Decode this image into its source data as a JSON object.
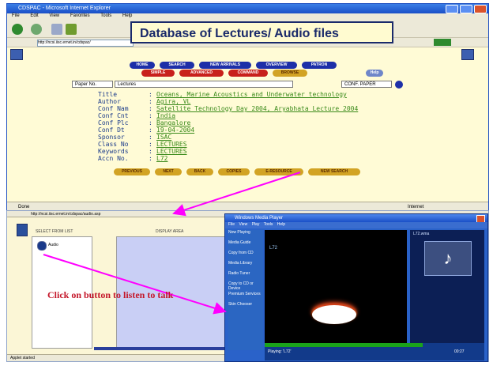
{
  "callout": "Database of Lectures/ Audio files",
  "annotation": "Click on button to listen to talk",
  "ie_window": {
    "title": "CDSPAC - Microsoft Internet Explorer",
    "menu": [
      "File",
      "Edit",
      "View",
      "Favorites",
      "Tools",
      "Help"
    ],
    "address": "http://ncsi.iisc.ernet.in/cdspac/",
    "status_left": "Done",
    "status_right": "Internet"
  },
  "nav_row1": [
    "HOME",
    "SEARCH",
    "NEW ARRIVALS",
    "OVERVIEW",
    "PATRON"
  ],
  "nav_row2": [
    "SIMPLE",
    "ADVANCED",
    "COMMAND",
    "BROWSE"
  ],
  "nav_help": "Help",
  "search_bar": {
    "field": "Paper No.",
    "value": "Lectures",
    "scope": "CONF. PAPER"
  },
  "record": [
    {
      "label": "Title",
      "value": "Oceans, Marine Acoustics and Underwater technology"
    },
    {
      "label": "Author",
      "value": "Agira, VL"
    },
    {
      "label": "Conf Nam",
      "value": "Satellite Technology Day 2004, Aryabhata Lecture 2004"
    },
    {
      "label": "Conf Cnt",
      "value": "India"
    },
    {
      "label": "Conf Plc",
      "value": "Bangalore"
    },
    {
      "label": "Conf Dt",
      "value": "19-04-2004"
    },
    {
      "label": "Sponsor",
      "value": "ISAC"
    },
    {
      "label": "Class No",
      "value": "LECTURES"
    },
    {
      "label": "Keywords",
      "value": "LECTURES"
    },
    {
      "label": "Accn No.",
      "value": "L72"
    }
  ],
  "record_actions": [
    "PREVIOUS",
    "NEXT",
    "BACK",
    "COPIES",
    "E-RESOURCE",
    "NEW SEARCH"
  ],
  "bottom_window": {
    "address": "http://ncsi.iisc.ernet.in/cdspac/audio.asp",
    "list_header": "SELECT FROM LIST",
    "display_header": "DISPLAY AREA",
    "list_item": "Audio",
    "status": "Applet started"
  },
  "media_player": {
    "title": "Windows Media Player",
    "menu": [
      "File",
      "View",
      "Play",
      "Tools",
      "Help"
    ],
    "side_menu": [
      "Now Playing",
      "Media Guide",
      "Copy from CD",
      "Media Library",
      "Radio Tuner",
      "Copy to CD or Device",
      "Premium Services",
      "Skin Chooser"
    ],
    "track_label": "L72",
    "right_header": "L72.wma",
    "status": "Playing: 'L72'",
    "time": "00:27"
  }
}
